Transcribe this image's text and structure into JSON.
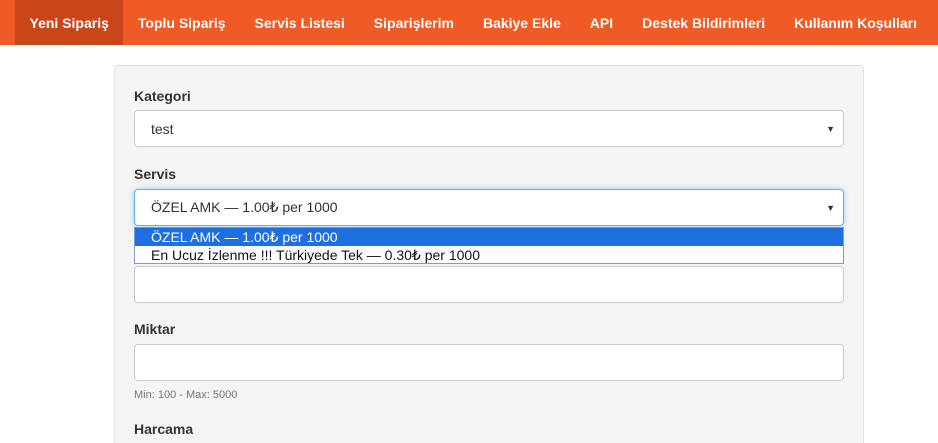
{
  "nav": {
    "items": [
      {
        "label": "Yeni Sipariş",
        "active": true
      },
      {
        "label": "Toplu Sipariş",
        "active": false
      },
      {
        "label": "Servis Listesi",
        "active": false
      },
      {
        "label": "Siparişlerim",
        "active": false
      },
      {
        "label": "Bakiye Ekle",
        "active": false
      },
      {
        "label": "API",
        "active": false
      },
      {
        "label": "Destek Bildirimleri",
        "active": false
      },
      {
        "label": "Kullanım Koşulları",
        "active": false
      }
    ]
  },
  "form": {
    "category_label": "Kategori",
    "category_value": "test",
    "service_label": "Servis",
    "service_value": "ÖZEL AMK — 1.00₺ per 1000",
    "service_options": [
      "ÖZEL AMK — 1.00₺ per 1000",
      "En Ucuz İzlenme !!! Türkiyede Tek — 0.30₺ per 1000"
    ],
    "quantity_label": "Miktar",
    "quantity_help": "Min: 100 - Max: 5000",
    "charge_label": "Harcama"
  },
  "colors": {
    "navbar": "#f05a24",
    "nav_active": "#c9461a",
    "option_selected": "#1e6fe0"
  }
}
